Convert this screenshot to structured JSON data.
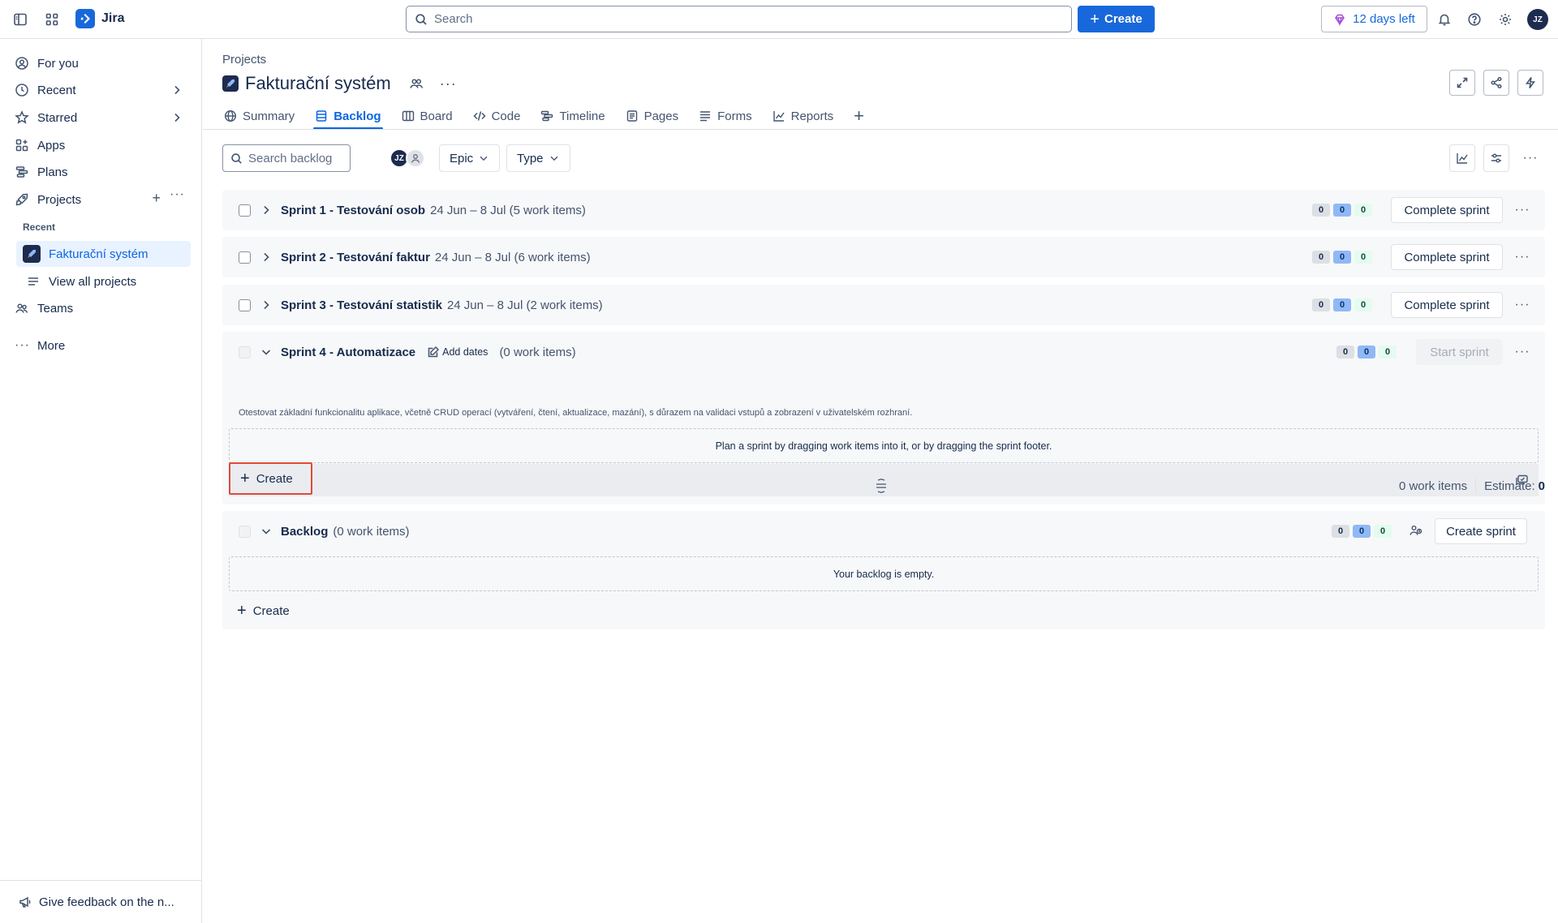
{
  "topbar": {
    "app_name": "Jira",
    "search_placeholder": "Search",
    "create_label": "Create",
    "trial_label": "12 days left",
    "avatar_initials": "JZ"
  },
  "sidebar": {
    "items": [
      {
        "label": "For you",
        "icon": "person-circle-icon"
      },
      {
        "label": "Recent",
        "icon": "clock-icon"
      },
      {
        "label": "Starred",
        "icon": "star-icon"
      },
      {
        "label": "Apps",
        "icon": "apps-icon"
      },
      {
        "label": "Plans",
        "icon": "plans-icon"
      },
      {
        "label": "Projects",
        "icon": "rocket-icon"
      }
    ],
    "recent_heading": "Recent",
    "active_project": "Fakturační systém",
    "view_all": "View all projects",
    "teams": "Teams",
    "more": "More",
    "feedback": "Give feedback on the n..."
  },
  "main": {
    "breadcrumb": "Projects",
    "title": "Fakturační systém",
    "tabs": [
      "Summary",
      "Backlog",
      "Board",
      "Code",
      "Timeline",
      "Pages",
      "Forms",
      "Reports"
    ],
    "active_tab": "Backlog",
    "filters": {
      "search_placeholder": "Search backlog",
      "avatar_initials": "JZ",
      "epic_label": "Epic",
      "type_label": "Type"
    },
    "sprints": [
      {
        "name": "Sprint 1 - Testování osob",
        "meta": "24 Jun – 8 Jul (5 work items)",
        "counts": [
          "0",
          "0",
          "0"
        ],
        "action": "Complete sprint"
      },
      {
        "name": "Sprint 2 - Testování faktur",
        "meta": "24 Jun – 8 Jul (6 work items)",
        "counts": [
          "0",
          "0",
          "0"
        ],
        "action": "Complete sprint"
      },
      {
        "name": "Sprint 3 - Testování statistik",
        "meta": "24 Jun – 8 Jul (2 work items)",
        "counts": [
          "0",
          "0",
          "0"
        ],
        "action": "Complete sprint"
      }
    ],
    "sprint4": {
      "name": "Sprint 4 - Automatizace",
      "add_dates": "Add dates",
      "meta": "(0 work items)",
      "counts": [
        "0",
        "0",
        "0"
      ],
      "action": "Start sprint",
      "description": "Otestovat základní funkcionalitu aplikace, včetně CRUD operací (vytváření, čtení, aktualizace, mazání), s důrazem na validaci vstupů a zobrazení v uživatelském rozhraní.",
      "empty_hint": "Plan a sprint by dragging work items into it, or by dragging the sprint footer.",
      "create_label": "Create"
    },
    "summary": {
      "work_items": "0 work items",
      "estimate_label": "Estimate:",
      "estimate_value": "0"
    },
    "backlog": {
      "name": "Backlog",
      "meta": "(0 work items)",
      "counts": [
        "0",
        "0",
        "0"
      ],
      "action": "Create sprint",
      "empty": "Your backlog is empty.",
      "create_label": "Create"
    }
  },
  "colors": {
    "brand": "#1868db",
    "highlight": "#e04b3a"
  }
}
